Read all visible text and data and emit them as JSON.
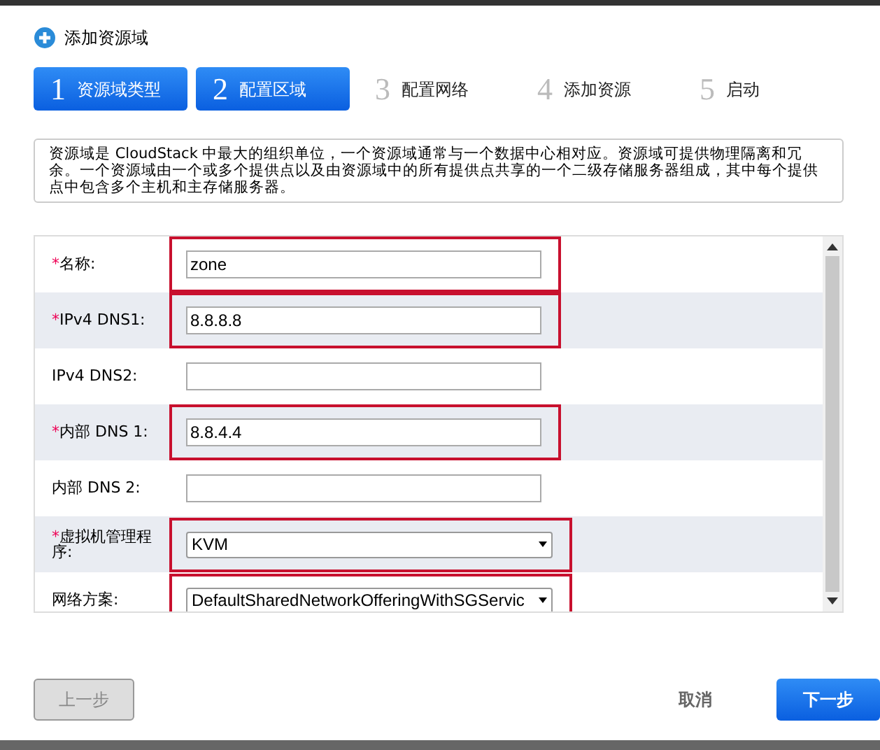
{
  "dialog": {
    "title": "添加资源域"
  },
  "steps": [
    {
      "number": "1",
      "label": "资源域类型",
      "completed": true
    },
    {
      "number": "2",
      "label": "配置区域",
      "completed": true
    },
    {
      "number": "3",
      "label": "配置网络",
      "completed": false
    },
    {
      "number": "4",
      "label": "添加资源",
      "completed": false
    },
    {
      "number": "5",
      "label": "启动",
      "completed": false
    }
  ],
  "description": "资源域是 CloudStack 中最大的组织单位，一个资源域通常与一个数据中心相对应。资源域可提供物理隔离和冗余。一个资源域由一个或多个提供点以及由资源域中的所有提供点共享的一个二级存储服务器组成，其中每个提供点中包含多个主机和主存储服务器。",
  "fields": [
    {
      "kind": "text",
      "label": "名称:",
      "required_mark": "*",
      "value": "zone",
      "highlighted": true
    },
    {
      "kind": "text",
      "label": "IPv4 DNS1:",
      "required_mark": "*",
      "value": "8.8.8.8",
      "highlighted": true
    },
    {
      "kind": "text",
      "label": "IPv4 DNS2:",
      "highlighted": false
    },
    {
      "kind": "text",
      "label": "内部 DNS 1:",
      "required_mark": "*",
      "value": "8.8.4.4",
      "highlighted": true
    },
    {
      "kind": "text",
      "label": "内部 DNS 2:",
      "highlighted": false
    },
    {
      "kind": "select",
      "label": "虚拟机管理程序:",
      "required_mark": "*",
      "value": "KVM",
      "highlighted": true
    },
    {
      "kind": "select",
      "label": "网络方案:",
      "value": "DefaultSharedNetworkOfferingWithSGServic",
      "highlighted": true
    }
  ],
  "buttons": {
    "back": {
      "label": "上一步",
      "disabled": true
    },
    "cancel": {
      "label": "取消"
    },
    "next": {
      "label": "下一步"
    }
  }
}
